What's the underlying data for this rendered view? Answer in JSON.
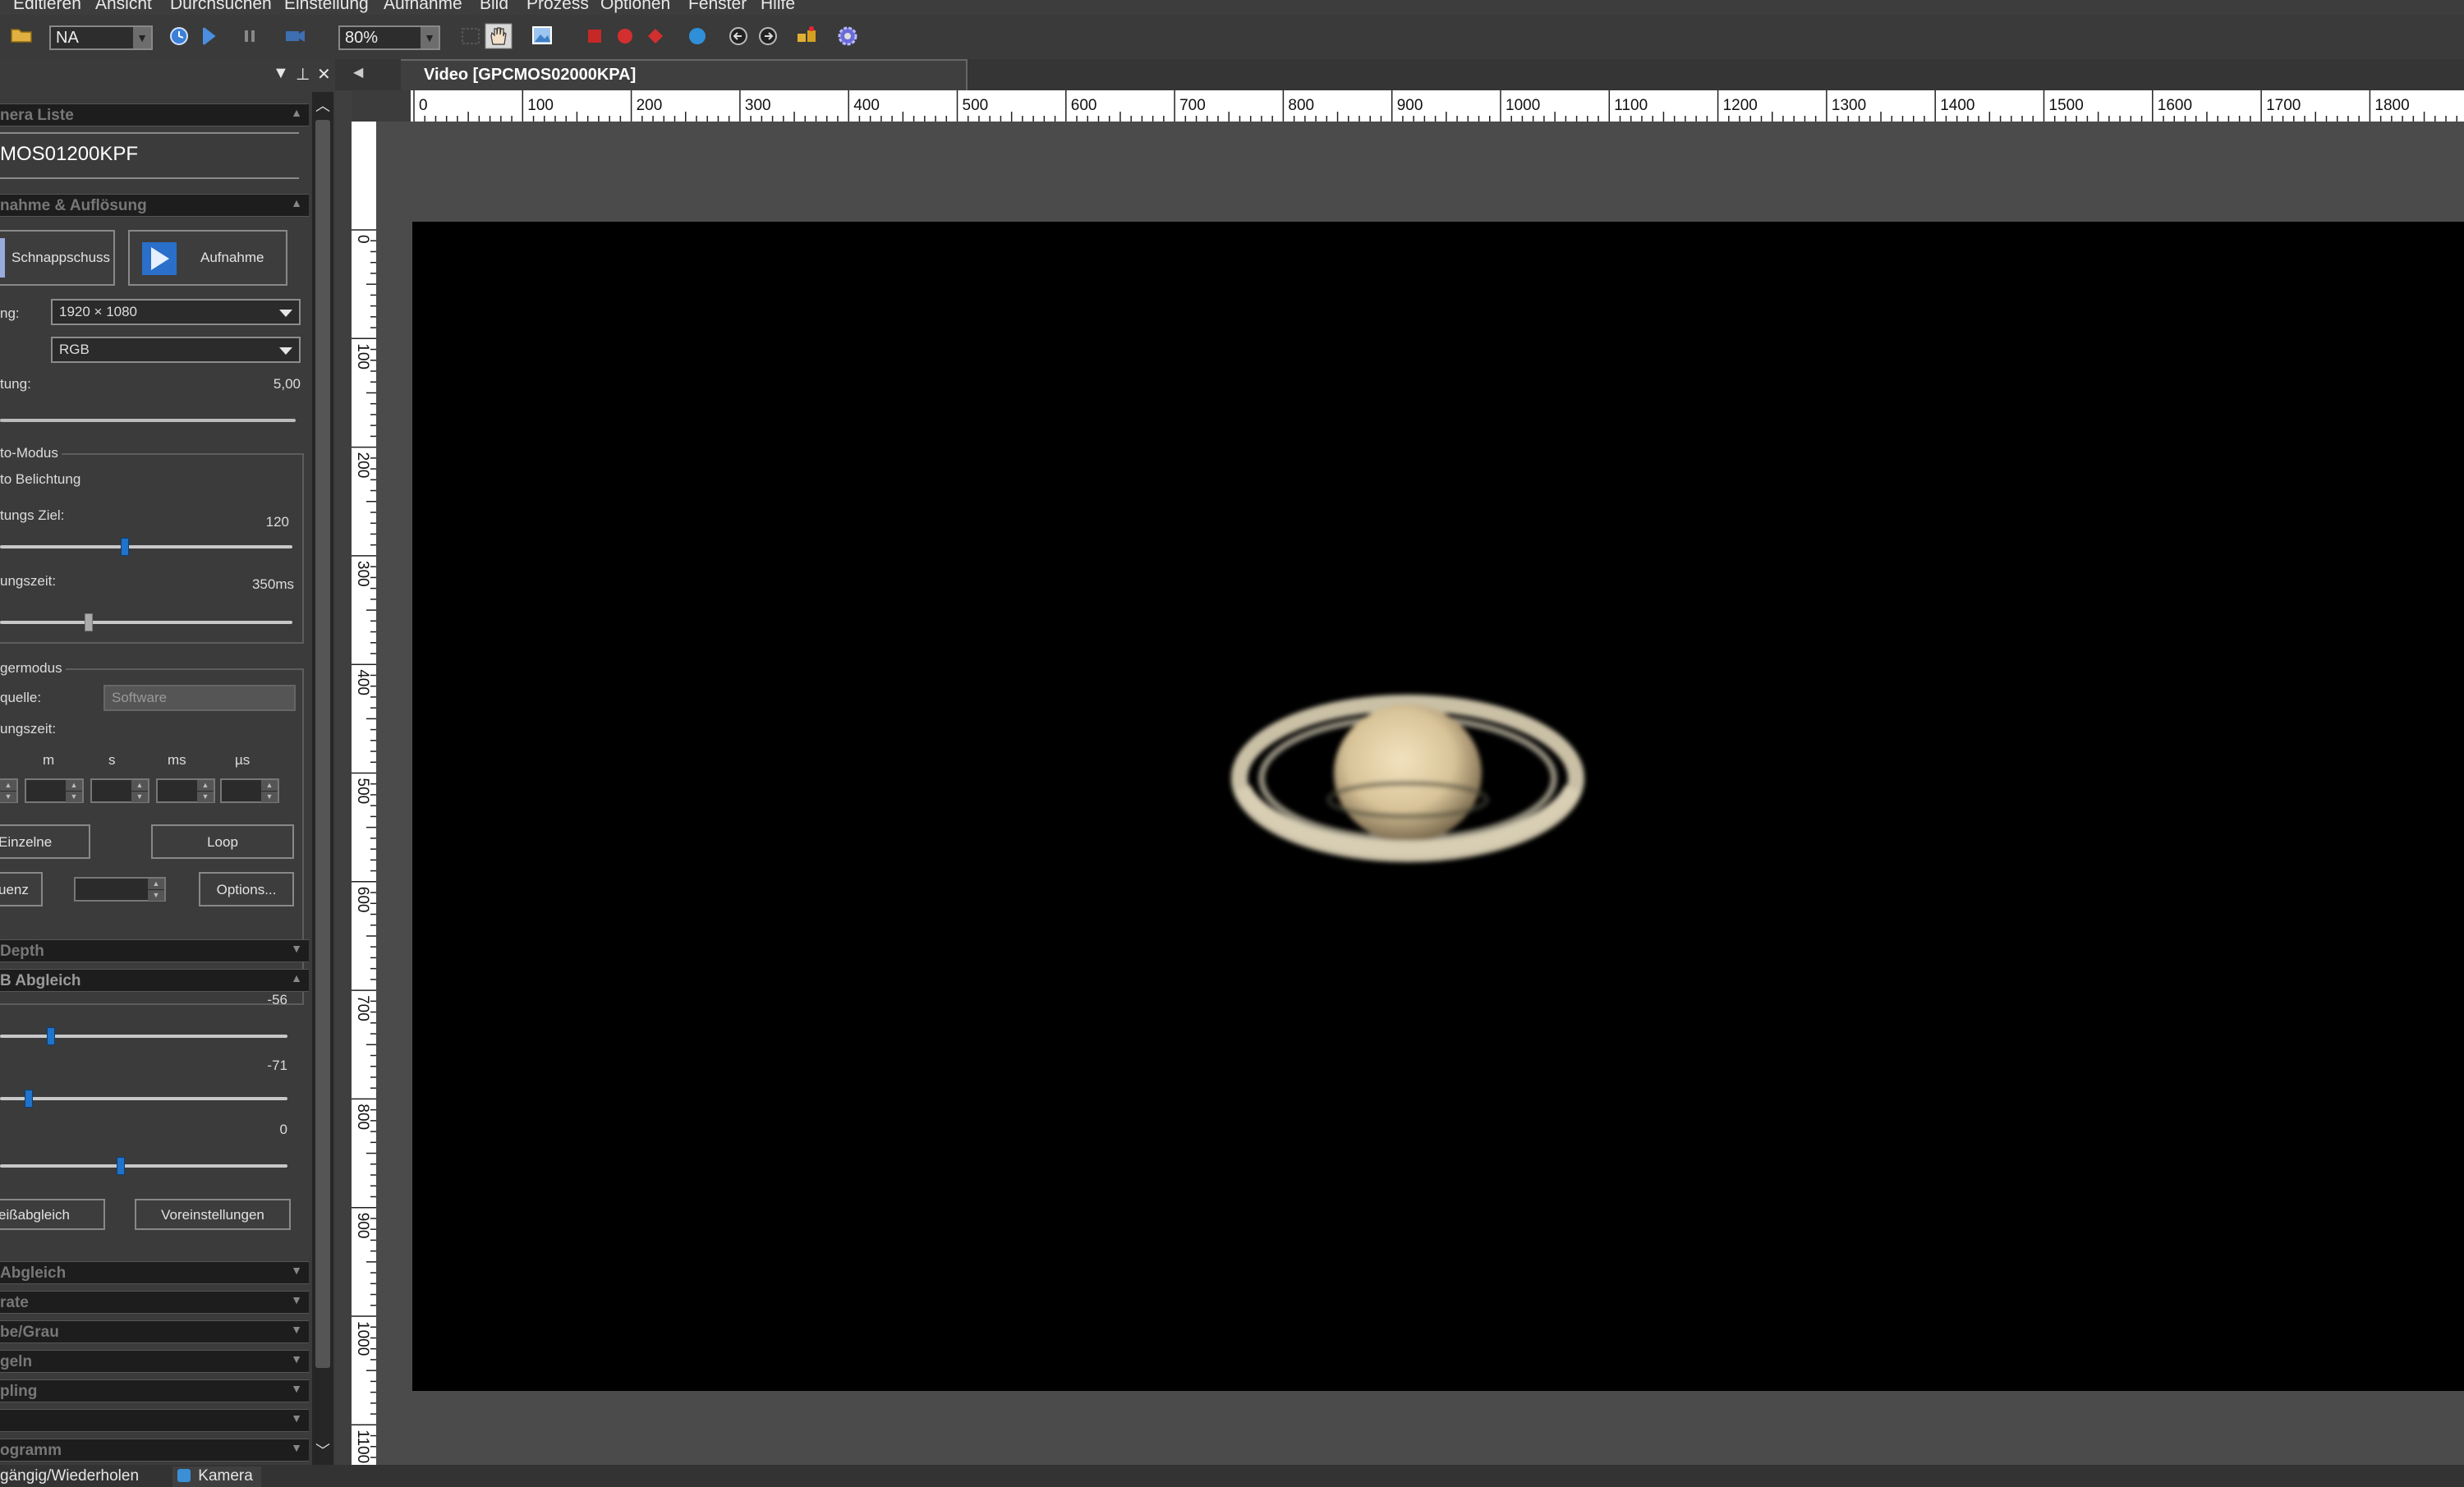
{
  "menu": [
    "Editieren",
    "Ansicht",
    "Durchsuchen",
    "Einstellung",
    "Aufnahme",
    "Bild",
    "Prozess",
    "Optionen",
    "Fenster",
    "Hilfe"
  ],
  "toolbar": {
    "camera_select": "NA",
    "zoom": "80%"
  },
  "panel": {
    "camera_list_title": "nera Liste",
    "camera_name": "MOS01200KPF",
    "capture_section": "nahme & Auflösung",
    "snapshot_label": "Schnappschuss",
    "record_label": "Aufnahme",
    "resolution_label": "ng:",
    "resolution_value": "1920 × 1080",
    "format_value": "RGB",
    "exposure_label": "tung:",
    "exposure_value": "5,00",
    "auto_mode_title": "to-Modus",
    "auto_exposure_label": "to Belichtung",
    "target_label": "tungs Ziel:",
    "target_value": "120",
    "time_label": "ungszeit:",
    "time_value": "350ms",
    "trigger_title": "germodus",
    "source_label": "quelle:",
    "source_value": "Software",
    "trigger_time_label": "ungszeit:",
    "time_units": [
      "m",
      "s",
      "ms",
      "µs"
    ],
    "single_button": "Einzelne",
    "loop_button": "Loop",
    "seq_button": "uenz",
    "options_button": "Options...",
    "depth_section": "Depth",
    "wb_section": "B Abgleich",
    "wb_values": [
      "-56",
      "-71",
      "0"
    ],
    "wb_levels": {
      "red": -56,
      "green": -71,
      "blue": 0
    },
    "whitebalance_button": "eißabgleich",
    "defaults_button": "Voreinstellungen",
    "collapsed_sections": [
      "Abgleich",
      "rate",
      "be/Grau",
      "geln",
      "pling",
      "",
      "ogramm"
    ]
  },
  "document": {
    "tab_title": "Video [GPCMOS02000KPA]",
    "ruler_h": [
      "0",
      "100",
      "200",
      "300",
      "400",
      "500",
      "600",
      "700",
      "800",
      "900",
      "1000",
      "1100",
      "1200",
      "1300",
      "1400",
      "1500",
      "1600",
      "1700",
      "1800"
    ],
    "ruler_v": [
      "0",
      "100",
      "200",
      "300",
      "400",
      "500",
      "600",
      "700",
      "800",
      "900",
      "1000",
      "1100"
    ]
  },
  "bottom_tabs": {
    "undo_tab": "gängig/Wiederholen",
    "camera_tab": "Kamera"
  },
  "colors": {
    "accent": "#1f73c9",
    "panel": "#3b3b3b",
    "section": "#1d1d1d",
    "video_bg": "#000000"
  }
}
